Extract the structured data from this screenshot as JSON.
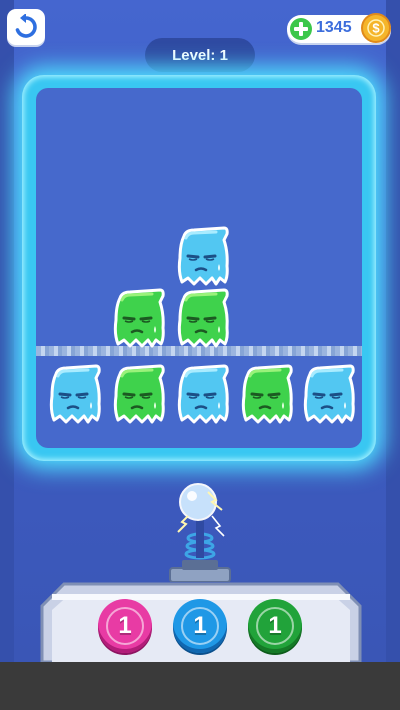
{
  "header": {
    "back_icon": "undo-arrow-icon",
    "coins": "1345",
    "add_icon": "plus-icon",
    "coin_icon": "dollar-coin-icon",
    "level_text": "Level: 1"
  },
  "board": {
    "top_rows": [
      [
        "",
        "",
        "blue",
        "",
        ""
      ],
      [
        "",
        "green",
        "green",
        "",
        ""
      ]
    ],
    "bottom_row": [
      "blue",
      "green",
      "blue",
      "green",
      "blue"
    ]
  },
  "shooter": {
    "icon": "tesla-coil-icon"
  },
  "tray": {
    "balls": [
      {
        "count": "1",
        "color": "#e83ba4"
      },
      {
        "count": "1",
        "color": "#1f98e6"
      },
      {
        "count": "1",
        "color": "#21a33a"
      }
    ]
  },
  "colors": {
    "blue_ghost": "#52c7f2",
    "green_ghost": "#3fd24c",
    "board_glow": "#4ee0ff",
    "background": "#4566cf"
  }
}
